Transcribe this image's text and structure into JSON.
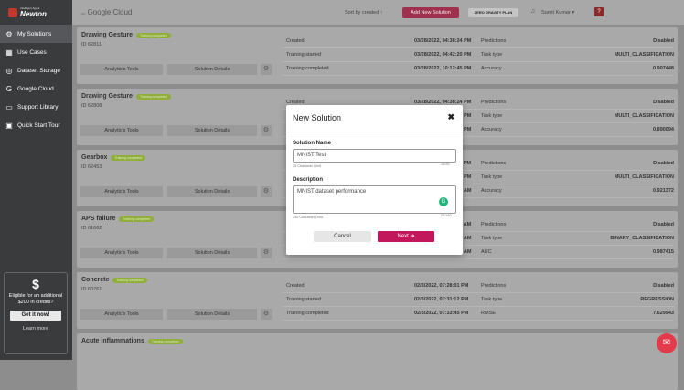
{
  "brand": {
    "small": "Intelligent Agent",
    "big": "Newton"
  },
  "nav": [
    {
      "icon": "gear-icon",
      "glyph": "⚙",
      "label": "My Solutions"
    },
    {
      "icon": "grid-icon",
      "glyph": "▦",
      "label": "Use Cases"
    },
    {
      "icon": "storage-icon",
      "glyph": "◎",
      "label": "Dataset Storage"
    },
    {
      "icon": "google-icon",
      "glyph": "G",
      "label": "Google Cloud"
    },
    {
      "icon": "book-icon",
      "glyph": "▭",
      "label": "Support Library"
    },
    {
      "icon": "monitor-icon",
      "glyph": "▣",
      "label": "Quick Start Tour"
    }
  ],
  "promo": {
    "symbol": "$",
    "text": "Eligible for an additional $200 in credits?",
    "cta": "Get it now!",
    "learn": "Learn more"
  },
  "topbar": {
    "cloud_prefix": "on",
    "cloud": "Google Cloud",
    "sort": "Sort by created ↑",
    "add": "Add New Solution",
    "plan": "ZERO GRAVITY PLAN",
    "user": "Sumit Kumar ▾",
    "help": "?"
  },
  "cards": [
    {
      "title": "Drawing Gesture",
      "badge": "Training completed",
      "id": "ID 62811",
      "b1": "Analytic's Tools",
      "b2": "Solution Details",
      "rows": [
        [
          "Created",
          "03/28/2022, 04:38:24 PM",
          "Predictions",
          "Disabled"
        ],
        [
          "Training started",
          "03/28/2022, 04:42:20 PM",
          "Task type",
          "MULTI_CLASSIFICATION"
        ],
        [
          "Training completed",
          "03/28/2022, 10:12:45 PM",
          "Accuracy",
          "0.907448"
        ]
      ]
    },
    {
      "title": "Drawing Gesture",
      "badge": "Training completed",
      "id": "ID 62808",
      "b1": "Analytic's Tools",
      "b2": "Solution Details",
      "rows": [
        [
          "Created",
          "03/28/2022, 04:38:24 PM",
          "Predictions",
          "Disabled"
        ],
        [
          "Training started",
          "03/28/2022, 04:42:20 PM",
          "Task type",
          "MULTI_CLASSIFICATION"
        ],
        [
          "Training completed",
          "03/28/2022, 10:12:45 PM",
          "Accuracy",
          "0.890094"
        ]
      ]
    },
    {
      "title": "Gearbox",
      "badge": "Training completed",
      "id": "ID 62453",
      "b1": "Analytic's Tools",
      "b2": "Solution Details",
      "rows": [
        [
          "Created",
          "03/22/2022, 12:10:11 PM",
          "Predictions",
          "Disabled"
        ],
        [
          "Training started",
          "03/22/2022, 12:14:05 PM",
          "Task type",
          "MULTI_CLASSIFICATION"
        ],
        [
          "Training completed",
          "03/22/2022, 03:40:19 AM",
          "Accuracy",
          "0.921372"
        ]
      ]
    },
    {
      "title": "APS failure",
      "badge": "Training completed",
      "id": "ID 61662",
      "b1": "Analytic's Tools",
      "b2": "Solution Details",
      "rows": [
        [
          "Created",
          "02/24/2022, 09:02:11 AM",
          "Predictions",
          "Disabled"
        ],
        [
          "Training started",
          "02/24/2022, 09:06:40 AM",
          "Task type",
          "BINARY_CLASSIFICATION"
        ],
        [
          "Training completed",
          "02/24/2022, 12:42:14 AM",
          "AUC",
          "0.987415"
        ]
      ]
    },
    {
      "title": "Concrete",
      "badge": "Training completed",
      "id": "ID 60761",
      "b1": "Analytic's Tools",
      "b2": "Solution Details",
      "rows": [
        [
          "Created",
          "02/3/2022, 07:28:01 PM",
          "Predictions",
          "Disabled"
        ],
        [
          "Training started",
          "02/3/2022, 07:31:12 PM",
          "Task type",
          "REGRESSION"
        ],
        [
          "Training completed",
          "02/3/2022, 07:33:45 PM",
          "RMSE",
          "7.629943"
        ]
      ]
    },
    {
      "title": "Acute inflammations",
      "badge": "Training completed",
      "id": "",
      "b1": "",
      "b2": "",
      "rows": []
    }
  ],
  "modal": {
    "title": "New Solution",
    "close": "✖",
    "name_label": "Solution Name",
    "name_value": "MNIST Test",
    "name_hint": "25 Character Limit",
    "name_count": "10/25",
    "desc_label": "Description",
    "desc_value": "MNIST dataset performance",
    "desc_hint": "140 Character Limit",
    "desc_count": "25/140",
    "cancel": "Cancel",
    "next": "Next ➔"
  }
}
